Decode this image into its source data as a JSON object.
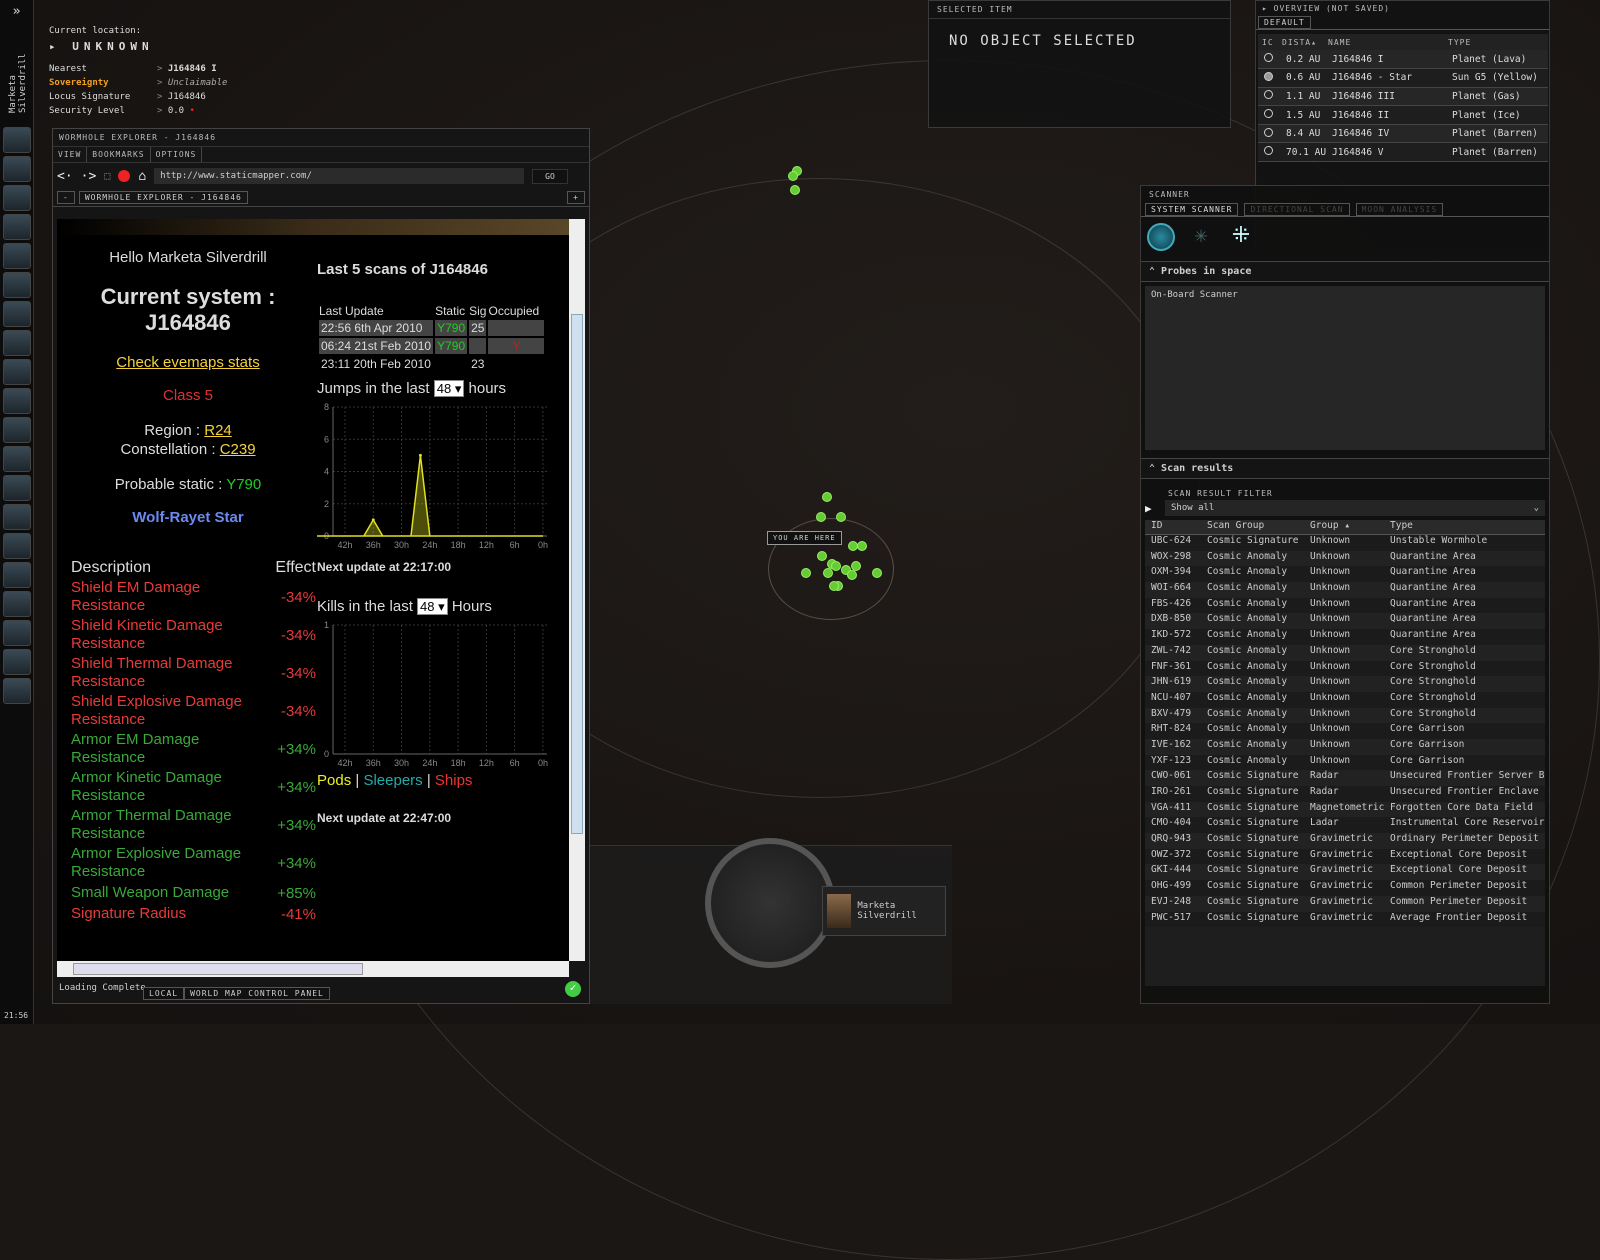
{
  "location": {
    "label": "Current location:",
    "name": "UNKNOWN",
    "rows": [
      {
        "k": "Nearest",
        "v": "J164846 I"
      },
      {
        "k": "Sovereignty",
        "v": "Unclaimable"
      },
      {
        "k": "Locus Signature",
        "v": "J164846"
      },
      {
        "k": "Security Level",
        "v": "0.0"
      }
    ]
  },
  "sidebar": {
    "character": "Marketa Silverdrill",
    "clock": "21:56"
  },
  "selected_item": {
    "header": "SELECTED ITEM",
    "text": "NO OBJECT SELECTED"
  },
  "overview": {
    "title": "OVERVIEW (NOT SAVED)",
    "tab": "DEFAULT",
    "columns": [
      "IC",
      "DISTA",
      "NAME",
      "TYPE"
    ],
    "rows": [
      {
        "dist": "0.2 AU",
        "name": "J164846 I",
        "type": "Planet (Lava)",
        "filled": false
      },
      {
        "dist": "0.6 AU",
        "name": "J164846 - Star",
        "type": "Sun G5 (Yellow)",
        "filled": true
      },
      {
        "dist": "1.1 AU",
        "name": "J164846 III",
        "type": "Planet (Gas)",
        "filled": false
      },
      {
        "dist": "1.5 AU",
        "name": "J164846 II",
        "type": "Planet (Ice)",
        "filled": false
      },
      {
        "dist": "8.4 AU",
        "name": "J164846 IV",
        "type": "Planet (Barren)",
        "filled": false
      },
      {
        "dist": "70.1 AU",
        "name": "J164846 V",
        "type": "Planet (Barren)",
        "filled": false
      }
    ]
  },
  "scanner": {
    "title": "SCANNER",
    "tabs": [
      "SYSTEM SCANNER",
      "DIRECTIONAL SCAN",
      "MOON ANALYSIS"
    ],
    "probes_title": "Probes in space",
    "probe_item": "On-Board Scanner",
    "results_title": "Scan results",
    "filter_label": "SCAN RESULT FILTER",
    "filter_value": "Show all",
    "columns": [
      "ID",
      "Scan Group",
      "Group",
      "Type"
    ],
    "rows": [
      [
        "UBC-624",
        "Cosmic Signature",
        "Unknown",
        "Unstable Wormhole"
      ],
      [
        "WOX-298",
        "Cosmic Anomaly",
        "Unknown",
        "Quarantine Area"
      ],
      [
        "OXM-394",
        "Cosmic Anomaly",
        "Unknown",
        "Quarantine Area"
      ],
      [
        "WOI-664",
        "Cosmic Anomaly",
        "Unknown",
        "Quarantine Area"
      ],
      [
        "FBS-426",
        "Cosmic Anomaly",
        "Unknown",
        "Quarantine Area"
      ],
      [
        "DXB-850",
        "Cosmic Anomaly",
        "Unknown",
        "Quarantine Area"
      ],
      [
        "IKD-572",
        "Cosmic Anomaly",
        "Unknown",
        "Quarantine Area"
      ],
      [
        "ZWL-742",
        "Cosmic Anomaly",
        "Unknown",
        "Core Stronghold"
      ],
      [
        "FNF-361",
        "Cosmic Anomaly",
        "Unknown",
        "Core Stronghold"
      ],
      [
        "JHN-619",
        "Cosmic Anomaly",
        "Unknown",
        "Core Stronghold"
      ],
      [
        "NCU-407",
        "Cosmic Anomaly",
        "Unknown",
        "Core Stronghold"
      ],
      [
        "BXV-479",
        "Cosmic Anomaly",
        "Unknown",
        "Core Stronghold"
      ],
      [
        "RHT-824",
        "Cosmic Anomaly",
        "Unknown",
        "Core Garrison"
      ],
      [
        "IVE-162",
        "Cosmic Anomaly",
        "Unknown",
        "Core Garrison"
      ],
      [
        "YXF-123",
        "Cosmic Anomaly",
        "Unknown",
        "Core Garrison"
      ],
      [
        "CWO-061",
        "Cosmic Signature",
        "Radar",
        "Unsecured Frontier Server Bank"
      ],
      [
        "IRO-261",
        "Cosmic Signature",
        "Radar",
        "Unsecured Frontier Enclave Relay"
      ],
      [
        "VGA-411",
        "Cosmic Signature",
        "Magnetometric",
        "Forgotten Core Data Field"
      ],
      [
        "CMO-404",
        "Cosmic Signature",
        "Ladar",
        "Instrumental Core Reservoir"
      ],
      [
        "QRQ-943",
        "Cosmic Signature",
        "Gravimetric",
        "Ordinary Perimeter Deposit"
      ],
      [
        "OWZ-372",
        "Cosmic Signature",
        "Gravimetric",
        "Exceptional Core Deposit"
      ],
      [
        "GKI-444",
        "Cosmic Signature",
        "Gravimetric",
        "Exceptional Core Deposit"
      ],
      [
        "OHG-499",
        "Cosmic Signature",
        "Gravimetric",
        "Common Perimeter Deposit"
      ],
      [
        "EVJ-248",
        "Cosmic Signature",
        "Gravimetric",
        "Common Perimeter Deposit"
      ],
      [
        "PWC-517",
        "Cosmic Signature",
        "Gravimetric",
        "Average Frontier Deposit"
      ]
    ]
  },
  "map": {
    "you_are_here": "YOU ARE HERE"
  },
  "hud": {
    "pilot": "Marketa Silverdrill"
  },
  "browser": {
    "title": "WORMHOLE EXPLORER - J164846",
    "menu": [
      "VIEW",
      "BOOKMARKS",
      "OPTIONS"
    ],
    "url": "http://www.staticmapper.com/",
    "go": "GO",
    "tab": "WORMHOLE EXPLORER - J164846",
    "status": "Loading Complete",
    "bottom_tabs": [
      "LOCAL",
      "WORLD MAP CONTROL PANEL"
    ]
  },
  "page": {
    "hello": "Hello Marketa Silverdrill",
    "current_system_label": "Current system :",
    "system": "J164846",
    "evemaps_link": "Check evemaps stats",
    "class": "Class 5",
    "region_label": "Region :",
    "region": "R24",
    "constellation_label": "Constellation :",
    "constellation": "C239",
    "static_label": "Probable static :",
    "static": "Y790",
    "effect_title": "Wolf-Rayet Star",
    "effect_headers": [
      "Description",
      "Effect"
    ],
    "effects": [
      {
        "d": "Shield EM Damage Resistance",
        "v": "-34%",
        "c": "#e83a3a"
      },
      {
        "d": "Shield Kinetic Damage Resistance",
        "v": "-34%",
        "c": "#e83a3a"
      },
      {
        "d": "Shield Thermal Damage Resistance",
        "v": "-34%",
        "c": "#e83a3a"
      },
      {
        "d": "Shield Explosive Damage Resistance",
        "v": "-34%",
        "c": "#e83a3a"
      },
      {
        "d": "Armor EM Damage Resistance",
        "v": "+34%",
        "c": "#3aa83a"
      },
      {
        "d": "Armor Kinetic Damage Resistance",
        "v": "+34%",
        "c": "#3aa83a"
      },
      {
        "d": "Armor Thermal Damage Resistance",
        "v": "+34%",
        "c": "#3aa83a"
      },
      {
        "d": "Armor Explosive Damage Resistance",
        "v": "+34%",
        "c": "#3aa83a"
      },
      {
        "d": "Small Weapon Damage",
        "v": "+85%",
        "c": "#3aa83a"
      },
      {
        "d": "Signature Radius",
        "v": "-41%",
        "c": "#e83a3a"
      }
    ],
    "scans_title": "Last 5 scans of J164846",
    "scan_headers": [
      "Last Update",
      "Static",
      "Sig",
      "Occupied"
    ],
    "scans": [
      [
        "22:56 6th Apr 2010",
        "Y790",
        "25",
        ""
      ],
      [
        "06:24 21st Feb 2010",
        "Y790",
        "",
        "Y"
      ],
      [
        "23:11 20th Feb 2010",
        "",
        "23",
        ""
      ]
    ],
    "jumps_label": "Jumps in the last",
    "jumps_hours": "48",
    "jumps_unit": "hours",
    "next_update_1": "Next update at 22:17:00",
    "kills_label": "Kills in the last",
    "kills_hours": "48",
    "kills_unit": "Hours",
    "legend": [
      "Pods",
      "Sleepers",
      "Ships"
    ],
    "legend_sep": "|",
    "next_update_2": "Next update at 22:47:00"
  },
  "chart_data": [
    {
      "type": "area",
      "title": "Jumps",
      "x": [
        "42h",
        "36h",
        "30h",
        "24h",
        "18h",
        "12h",
        "6h",
        "0h"
      ],
      "x_hours": [
        48,
        46,
        44,
        42,
        40,
        38,
        36,
        34,
        32,
        30,
        28,
        26,
        24,
        22,
        20,
        18,
        16,
        14,
        12,
        10,
        8,
        6,
        4,
        2,
        0
      ],
      "y": [
        0,
        0,
        0,
        0,
        0,
        0,
        1,
        0,
        0,
        0,
        0,
        5,
        0,
        0,
        0,
        0,
        0,
        0,
        0,
        0,
        0,
        0,
        0,
        0,
        0
      ],
      "yticks": [
        0,
        2,
        4,
        6,
        8
      ],
      "ylim": [
        0,
        8
      ],
      "color": "#e0e020"
    },
    {
      "type": "area",
      "title": "Kills",
      "x": [
        "42h",
        "36h",
        "30h",
        "24h",
        "18h",
        "12h",
        "6h",
        "0h"
      ],
      "series": [
        {
          "name": "Pods",
          "values": [
            0
          ]
        },
        {
          "name": "Sleepers",
          "values": [
            0
          ]
        },
        {
          "name": "Ships",
          "values": [
            0
          ]
        }
      ],
      "yticks": [
        0,
        1
      ],
      "ylim": [
        0,
        1
      ]
    }
  ]
}
